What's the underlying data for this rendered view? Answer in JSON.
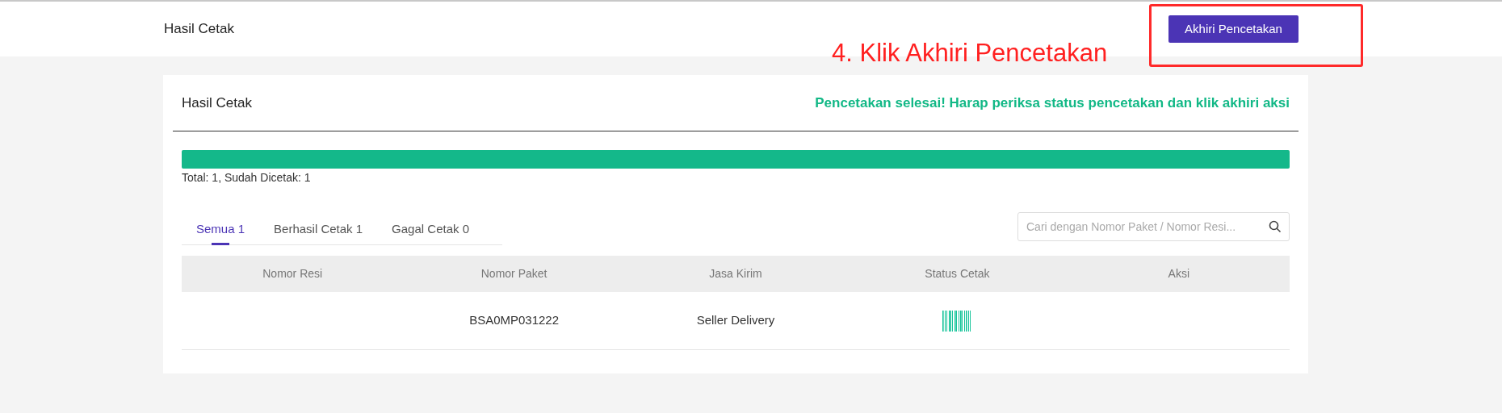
{
  "header": {
    "title": "Hasil Cetak",
    "end_button": "Akhiri Pencetakan"
  },
  "annotation": {
    "text": "4. Klik Akhiri Pencetakan"
  },
  "card": {
    "title": "Hasil Cetak",
    "message": "Pencetakan selesai! Harap periksa status pencetakan dan klik akhiri aksi",
    "progress": {
      "level": 1
    },
    "summary": "Total: 1, Sudah Dicetak: 1",
    "tabs": [
      {
        "label": "Semua 1",
        "selected": true
      },
      {
        "label": "Berhasil Cetak 1",
        "selected": false
      },
      {
        "label": "Gagal Cetak 0",
        "selected": false
      }
    ],
    "search": {
      "placeholder": "Cari dengan Nomor Paket / Nomor Resi..."
    },
    "table": {
      "columns": [
        "Nomor Resi",
        "Nomor Paket",
        "Jasa Kirim",
        "Status Cetak",
        "Aksi"
      ],
      "rows": [
        {
          "cells": [
            "",
            "BSA0MP031222",
            "Seller Delivery"
          ],
          "printed": true
        }
      ]
    }
  }
}
